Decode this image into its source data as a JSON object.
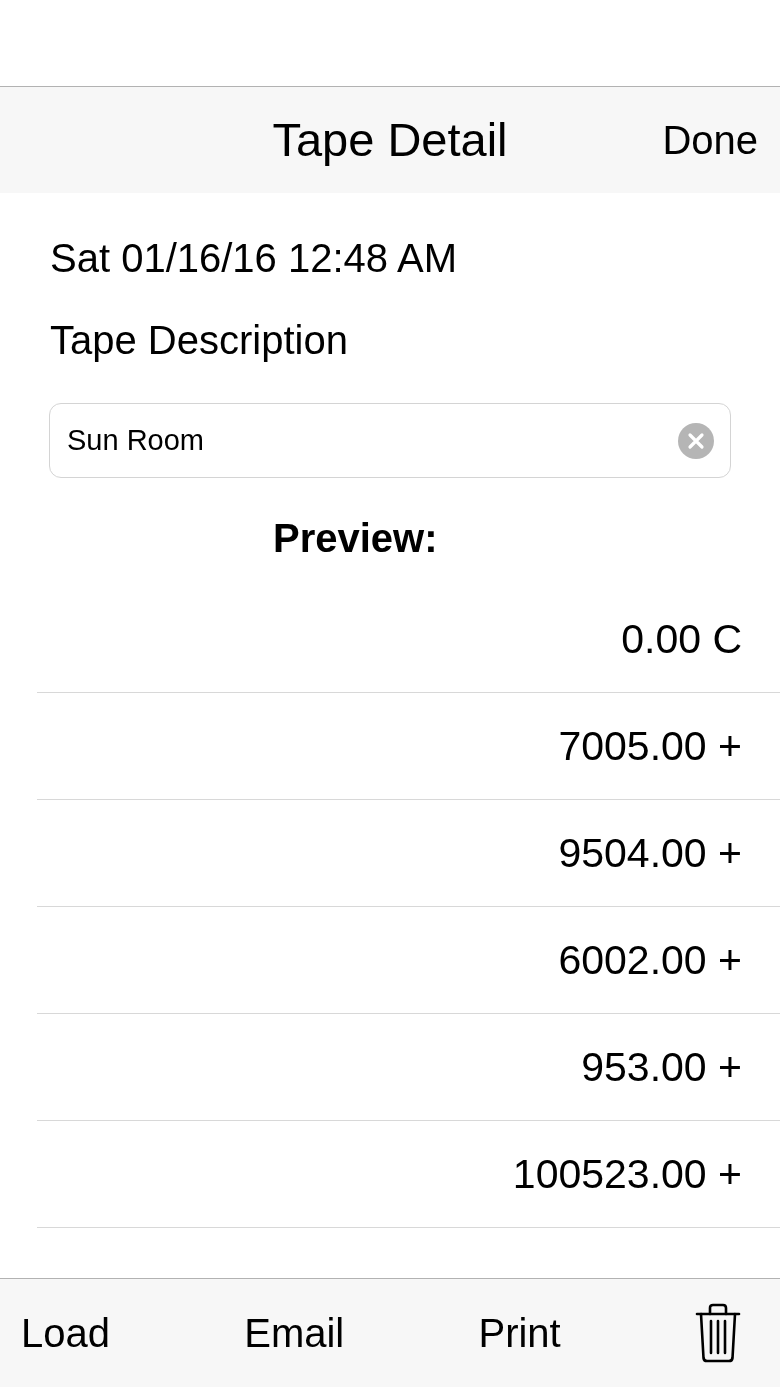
{
  "nav_bar": {
    "title": "Tape Detail",
    "done_button": "Done"
  },
  "date": "Sat 01/16/16 12:48 AM",
  "description": {
    "label": "Tape Description",
    "value": "Sun Room"
  },
  "preview": {
    "heading": "Preview:",
    "entries": [
      "0.00 C",
      "7005.00 +",
      "9504.00 +",
      "6002.00 +",
      "953.00 +",
      "100523.00 +"
    ]
  },
  "toolbar": {
    "buttons": [
      "Load",
      "Email",
      "Print"
    ]
  }
}
